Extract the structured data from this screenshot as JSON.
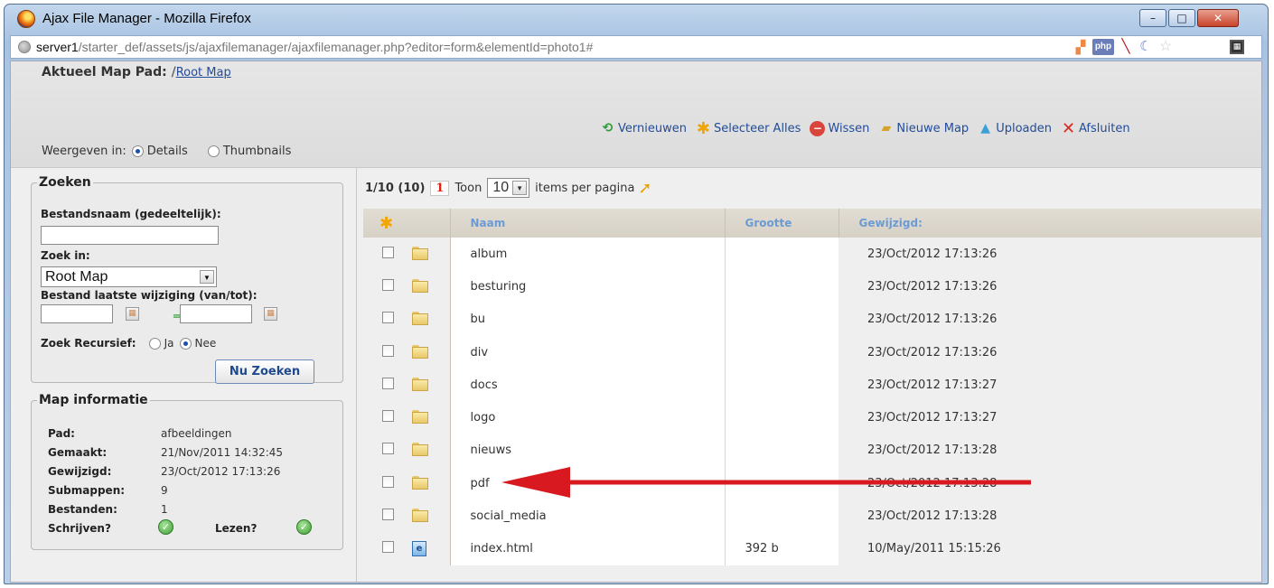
{
  "window": {
    "title": "Ajax File Manager - Mozilla Firefox",
    "min": "–",
    "max": "□",
    "close": "✕"
  },
  "address": {
    "host": "server1",
    "path": "/starter_def/assets/js/ajaxfilemanager/ajaxfilemanager.php?editor=form&elementId=photo1#"
  },
  "header": {
    "path_label": "Aktueel Map Pad:",
    "path_prefix": "/",
    "path_link": "Root Map",
    "view_label": "Weergeven in:",
    "view_details": "Details",
    "view_thumbnails": "Thumbnails"
  },
  "toolbar": {
    "refresh": "Vernieuwen",
    "select_all": "Selecteer Alles",
    "delete": "Wissen",
    "new_folder": "Nieuwe Map",
    "upload": "Uploaden",
    "close": "Afsluiten"
  },
  "search": {
    "legend": "Zoeken",
    "filename_label": "Bestandsnaam (gedeeltelijk):",
    "filename_value": "",
    "search_in_label": "Zoek in:",
    "search_in_value": "Root Map",
    "modified_label": "Bestand laatste wijziging (van/tot):",
    "recursive_label": "Zoek Recursief:",
    "recursive_yes": "Ja",
    "recursive_no": "Nee",
    "button": "Nu Zoeken"
  },
  "info": {
    "legend": "Map informatie",
    "rows": [
      {
        "key": "Pad:",
        "value": "afbeeldingen"
      },
      {
        "key": "Gemaakt:",
        "value": "21/Nov/2011 14:32:45"
      },
      {
        "key": "Gewijzigd:",
        "value": "23/Oct/2012 17:13:26"
      },
      {
        "key": "Submappen:",
        "value": "9"
      },
      {
        "key": "Bestanden:",
        "value": "1"
      }
    ],
    "write_label": "Schrijven?",
    "read_label": "Lezen?"
  },
  "pager": {
    "count": "1/10 (10)",
    "page": "1",
    "show_label": "Toon",
    "per_page": "10",
    "per_page_label": "items per pagina"
  },
  "table": {
    "col_name": "Naam",
    "col_size": "Grootte",
    "col_modified": "Gewijzigd:",
    "rows": [
      {
        "name": "album",
        "size": "",
        "modified": "23/Oct/2012 17:13:26",
        "type": "folder"
      },
      {
        "name": "besturing",
        "size": "",
        "modified": "23/Oct/2012 17:13:26",
        "type": "folder"
      },
      {
        "name": "bu",
        "size": "",
        "modified": "23/Oct/2012 17:13:26",
        "type": "folder"
      },
      {
        "name": "div",
        "size": "",
        "modified": "23/Oct/2012 17:13:26",
        "type": "folder"
      },
      {
        "name": "docs",
        "size": "",
        "modified": "23/Oct/2012 17:13:27",
        "type": "folder"
      },
      {
        "name": "logo",
        "size": "",
        "modified": "23/Oct/2012 17:13:27",
        "type": "folder"
      },
      {
        "name": "nieuws",
        "size": "",
        "modified": "23/Oct/2012 17:13:28",
        "type": "folder"
      },
      {
        "name": "pdf",
        "size": "",
        "modified": "23/Oct/2012 17:13:28",
        "type": "folder"
      },
      {
        "name": "social_media",
        "size": "",
        "modified": "23/Oct/2012 17:13:28",
        "type": "folder"
      },
      {
        "name": "index.html",
        "size": "392 b",
        "modified": "10/May/2011 15:15:26",
        "type": "file"
      }
    ]
  },
  "colors": {
    "link": "#224c9a",
    "annotation_arrow": "#d8191f",
    "header_text": "#6b9bd4"
  }
}
